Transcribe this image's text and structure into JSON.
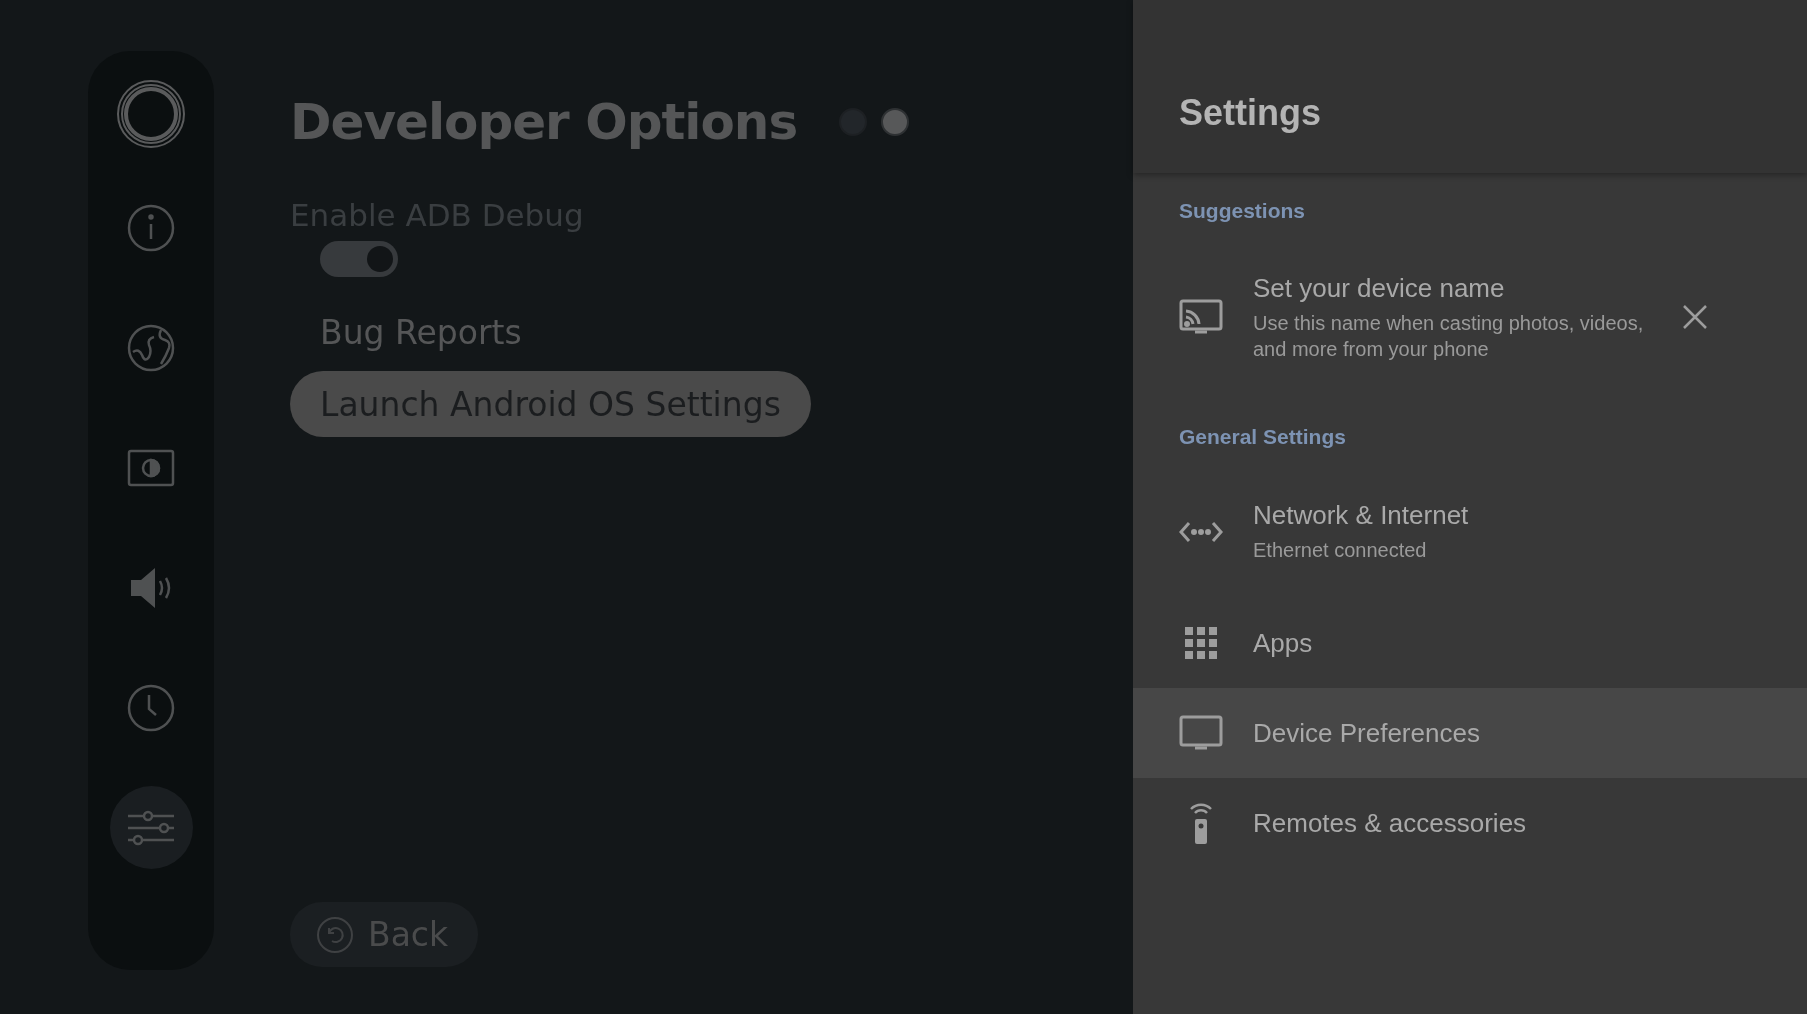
{
  "sidebar": {
    "items": [
      {
        "selected": false
      },
      {
        "selected": false
      },
      {
        "selected": false
      },
      {
        "selected": false
      },
      {
        "selected": false
      },
      {
        "selected": true
      }
    ]
  },
  "page": {
    "title": "Developer Options",
    "pager": [
      {
        "selected": false
      },
      {
        "selected": true
      }
    ],
    "toggle": {
      "label": "Enable ADB Debug",
      "on": true
    },
    "actions": [
      {
        "label": "Bug Reports",
        "selected": false
      },
      {
        "label": "Launch Android OS Settings",
        "selected": true
      }
    ],
    "back": "Back"
  },
  "settings": {
    "title": "Settings",
    "sections": [
      {
        "heading": "Suggestions",
        "items": [
          {
            "title": "Set your device name",
            "subtitle": "Use this name when casting photos, videos, and more from your phone",
            "dismissible": true,
            "selected": false
          }
        ]
      },
      {
        "heading": "General Settings",
        "items": [
          {
            "title": "Network & Internet",
            "subtitle": "Ethernet connected",
            "selected": false
          },
          {
            "title": "Apps",
            "selected": false
          },
          {
            "title": "Device Preferences",
            "selected": true
          },
          {
            "title": "Remotes & accessories",
            "selected": false
          }
        ]
      }
    ]
  }
}
